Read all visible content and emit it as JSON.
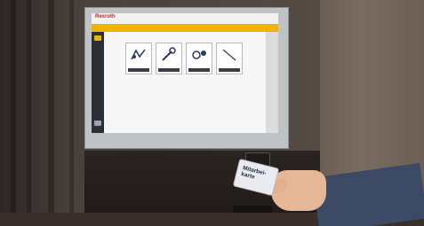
{
  "screen": {
    "brand": "Rexroth",
    "app_title": "",
    "tiles": [
      {
        "label": ""
      },
      {
        "label": ""
      },
      {
        "label": ""
      },
      {
        "label": ""
      }
    ]
  },
  "card": {
    "text_line1": "Mitarbei-",
    "text_line2": "karte"
  },
  "colors": {
    "accent": "#f0b400",
    "brand_red": "#c0282d",
    "sleeve": "#3c4a66"
  }
}
